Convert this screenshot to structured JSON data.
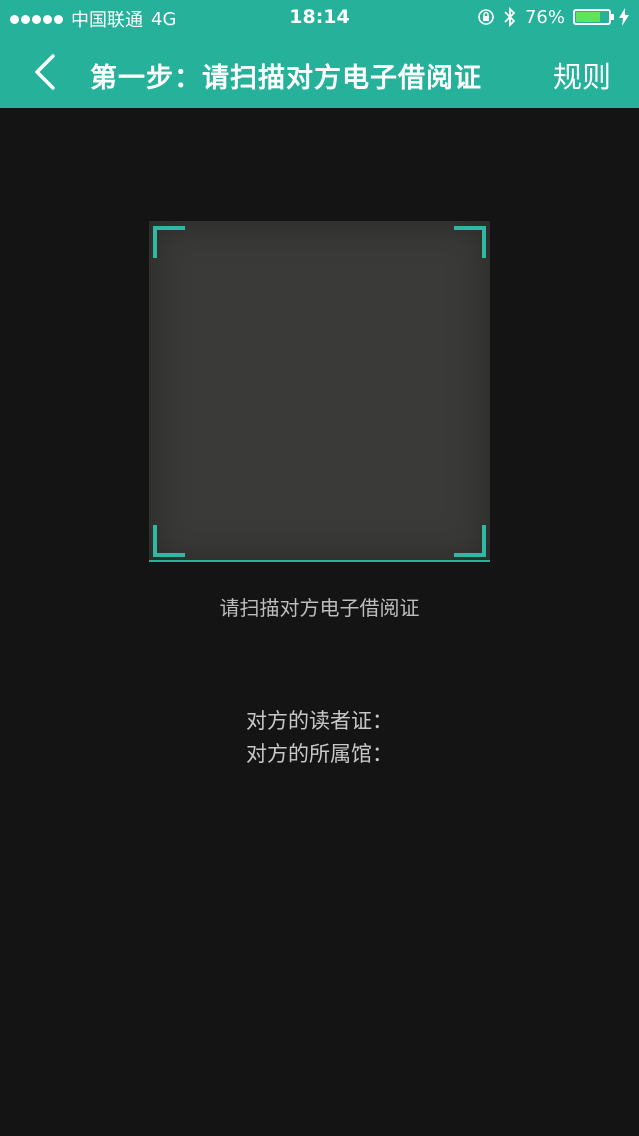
{
  "status_bar": {
    "carrier": "中国联通",
    "network": "4G",
    "time": "18:14",
    "battery_text": "76%",
    "battery_level": 0.76,
    "icons": [
      "signal-dots",
      "orientation-lock-icon",
      "bluetooth-icon",
      "battery-icon",
      "charging-icon"
    ]
  },
  "nav": {
    "back_icon": "chevron-left-icon",
    "title": "第一步：请扫描对方电子借阅证",
    "right_action": "规则"
  },
  "scanner": {
    "hint": "请扫描对方电子借阅证"
  },
  "info": {
    "reader_card_label": "对方的读者证：",
    "library_label": "对方的所属馆："
  },
  "colors": {
    "accent": "#26b19b",
    "background": "#141414",
    "battery_fill": "#5ee35a"
  }
}
